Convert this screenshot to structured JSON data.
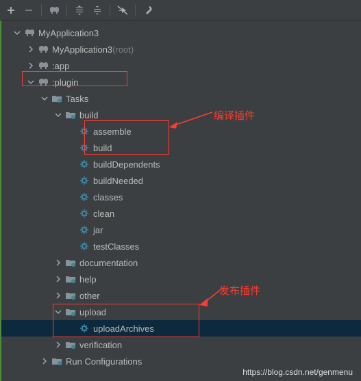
{
  "toolbar": {
    "icons": [
      "plus",
      "minus",
      "elephant",
      "expand",
      "collapse",
      "offline",
      "wrench"
    ]
  },
  "tree": {
    "root": {
      "label": "MyApplication3",
      "children": [
        {
          "label": "MyApplication3",
          "suffix": " (root)",
          "icon": "elephant"
        },
        {
          "label": ":app",
          "icon": "elephant"
        },
        {
          "label": ":plugin",
          "icon": "elephant",
          "expanded": true,
          "children": [
            {
              "label": "Tasks",
              "icon": "folder-gear",
              "expanded": true,
              "children": [
                {
                  "label": "build",
                  "icon": "folder-gear",
                  "expanded": true,
                  "children": [
                    {
                      "label": "assemble",
                      "icon": "gear"
                    },
                    {
                      "label": "build",
                      "icon": "gear"
                    },
                    {
                      "label": "buildDependents",
                      "icon": "gear"
                    },
                    {
                      "label": "buildNeeded",
                      "icon": "gear"
                    },
                    {
                      "label": "classes",
                      "icon": "gear"
                    },
                    {
                      "label": "clean",
                      "icon": "gear"
                    },
                    {
                      "label": "jar",
                      "icon": "gear"
                    },
                    {
                      "label": "testClasses",
                      "icon": "gear"
                    }
                  ]
                },
                {
                  "label": "documentation",
                  "icon": "folder-gear"
                },
                {
                  "label": "help",
                  "icon": "folder-gear"
                },
                {
                  "label": "other",
                  "icon": "folder-gear"
                },
                {
                  "label": "upload",
                  "icon": "folder-gear",
                  "expanded": true,
                  "children": [
                    {
                      "label": "uploadArchives",
                      "icon": "gear",
                      "selected": true
                    }
                  ]
                },
                {
                  "label": "verification",
                  "icon": "folder-gear"
                }
              ]
            },
            {
              "label": "Run Configurations",
              "icon": "folder-gear"
            }
          ]
        }
      ]
    }
  },
  "annotations": {
    "compile": "编译插件",
    "publish": "发布插件"
  },
  "watermark": "https://blog.csdn.net/genmenu"
}
